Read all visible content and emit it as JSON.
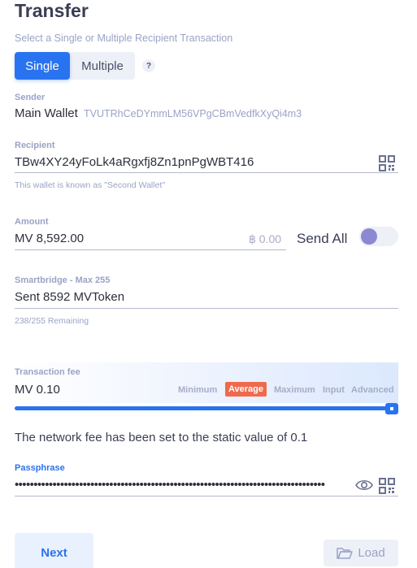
{
  "page": {
    "title": "Transfer",
    "subtitle": "Select a Single or Multiple Recipient Transaction"
  },
  "mode_toggle": {
    "single_label": "Single",
    "multiple_label": "Multiple",
    "selected": "Single",
    "help_label": "?"
  },
  "sender": {
    "label": "Sender",
    "wallet_name": "Main Wallet",
    "address": "TVUTRhCeDYmmLM56VPgCBmVedfkXyQi4m3"
  },
  "recipient": {
    "label": "Recipient",
    "value": "TBw4XY24yFoLk4aRgxfj8Zn1pnPgWBT416",
    "known_as": "This wallet is known as \"Second Wallet\""
  },
  "amount": {
    "label": "Amount",
    "value": "MV 8,592.00",
    "fiat": "฿ 0.00",
    "send_all_label": "Send All",
    "send_all_enabled": false
  },
  "smartbridge": {
    "label": "Smartbridge - Max 255",
    "value": "Sent 8592 MVToken",
    "remaining": "238/255 Remaining"
  },
  "fee": {
    "label": "Transaction fee",
    "value": "MV 0.10",
    "options": {
      "minimum": "Minimum",
      "average": "Average",
      "maximum": "Maximum",
      "input": "Input",
      "advanced": "Advanced"
    },
    "selected": "Average",
    "slider_fraction": 1.0,
    "note": "The network fee has been set to the static value of 0.1"
  },
  "passphrase": {
    "label": "Passphrase",
    "masked_value": "••••••••••••••••••••••••••••••••••••••••••••••••••••••••••••••••••••••••••••••••••"
  },
  "actions": {
    "next_label": "Next",
    "load_label": "Load"
  },
  "colors": {
    "accent": "#2a73f0",
    "average_badge": "#ef6a4c",
    "muted_text": "#9aa3c6",
    "toggle_knob": "#8c89d2"
  },
  "icons": {
    "help": "question-icon",
    "qr": "qr-code-icon",
    "eye": "eye-icon",
    "load": "folder-open-icon"
  }
}
